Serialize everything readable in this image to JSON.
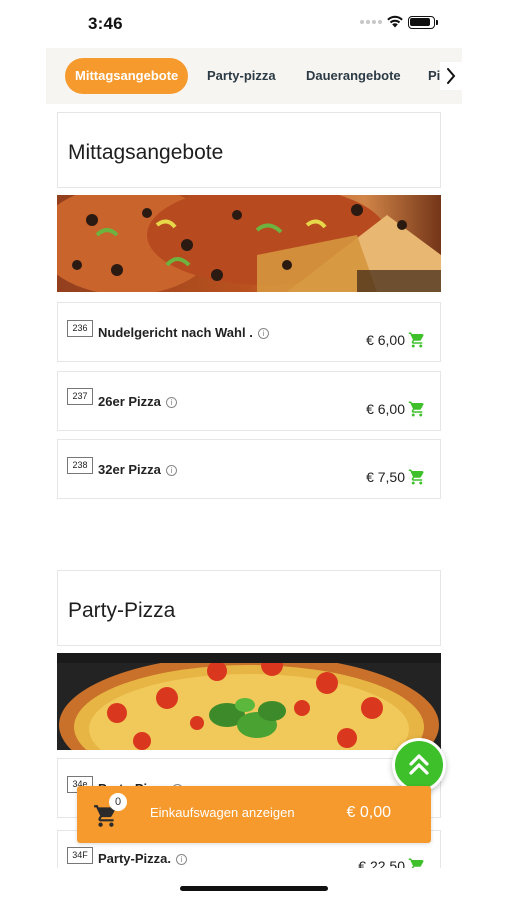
{
  "status": {
    "time": "3:46"
  },
  "tabs": [
    {
      "label": "Mittagsangebote"
    },
    {
      "label": "Party-pizza"
    },
    {
      "label": "Dauerangebote"
    },
    {
      "label": "Pi"
    }
  ],
  "sections": [
    {
      "title": "Mittagsangebote",
      "items": [
        {
          "number": "236",
          "name": "Nudelgericht nach Wahl .",
          "price": "€ 6,00"
        },
        {
          "number": "237",
          "name": "26er Pizza",
          "price": "€ 6,00"
        },
        {
          "number": "238",
          "name": "32er Pizza",
          "price": "€ 7,50"
        }
      ]
    },
    {
      "title": "Party-Pizza",
      "items": [
        {
          "number": "34e",
          "name": "Party-Pizza",
          "price": ""
        },
        {
          "number": "34F",
          "name": "Party-Pizza.",
          "price": "€ 22,50"
        }
      ]
    }
  ],
  "cart": {
    "count": "0",
    "label": "Einkaufswagen anzeigen",
    "total": "€ 0,00"
  },
  "info_glyph": "i",
  "colors": {
    "accent": "#f79a2e",
    "cart_green": "#3ec02b",
    "tab_text": "#2b3a44"
  },
  "icons": [
    "wifi-icon",
    "battery-icon",
    "chevron-right-icon",
    "info-icon",
    "add-to-cart-icon",
    "scroll-top-icon",
    "shopping-cart-icon"
  ]
}
